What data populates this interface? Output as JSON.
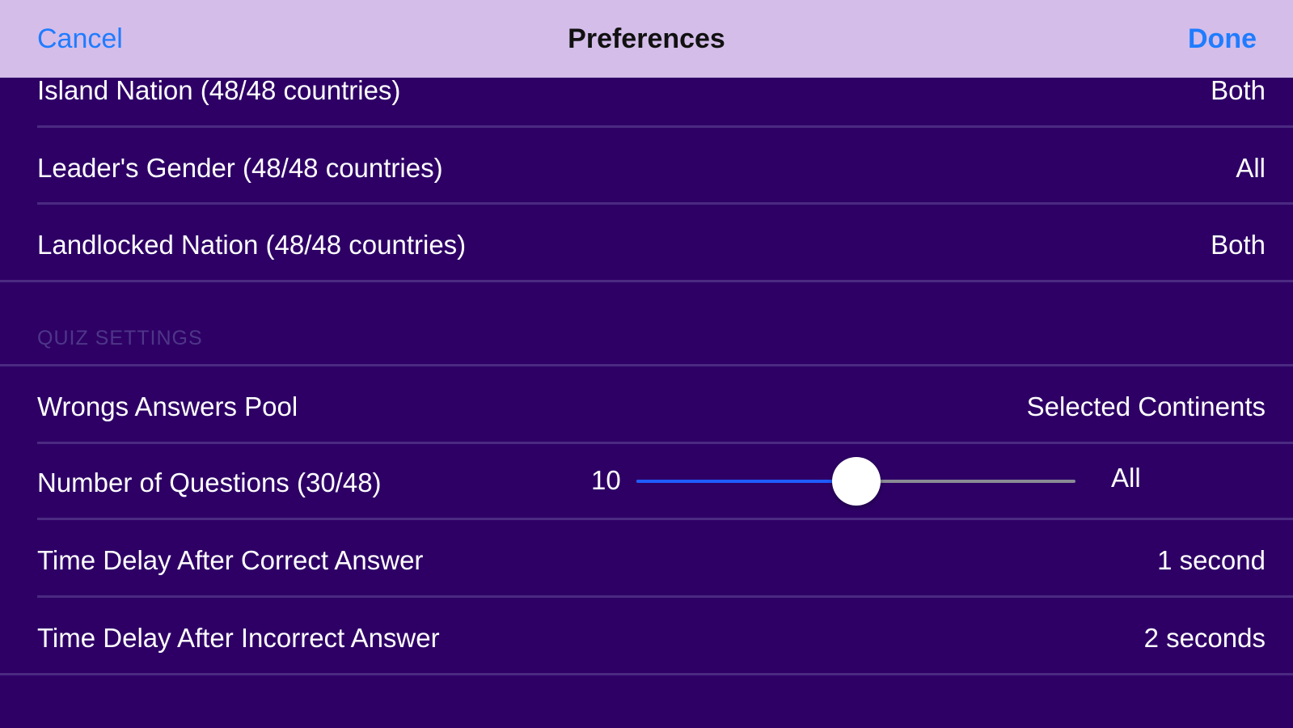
{
  "navbar": {
    "cancel_label": "Cancel",
    "title": "Preferences",
    "done_label": "Done"
  },
  "filters": [
    {
      "label": "Island Nation (48/48 countries)",
      "value": "Both"
    },
    {
      "label": "Leader's Gender (48/48 countries)",
      "value": "All"
    },
    {
      "label": "Landlocked Nation (48/48 countries)",
      "value": "Both"
    }
  ],
  "quiz_settings": {
    "header": "QUIZ SETTINGS",
    "wrong_answers_pool": {
      "label": "Wrongs Answers Pool",
      "value": "Selected Continents"
    },
    "number_of_questions": {
      "label": "Number of Questions (30/48)",
      "min_label": "10",
      "max_label": "All",
      "level": 0.5
    },
    "delay_correct": {
      "label": "Time Delay After Correct Answer",
      "value": "1 second"
    },
    "delay_incorrect": {
      "label": "Time Delay After Incorrect Answer",
      "value": "2 seconds"
    }
  },
  "colors": {
    "background": "#2e0066",
    "navbar": "#d4bde9",
    "accent": "#1f7cff",
    "slider_fill": "#1f5cff",
    "separator": "#4b2a82",
    "section_header": "#4e3688"
  }
}
